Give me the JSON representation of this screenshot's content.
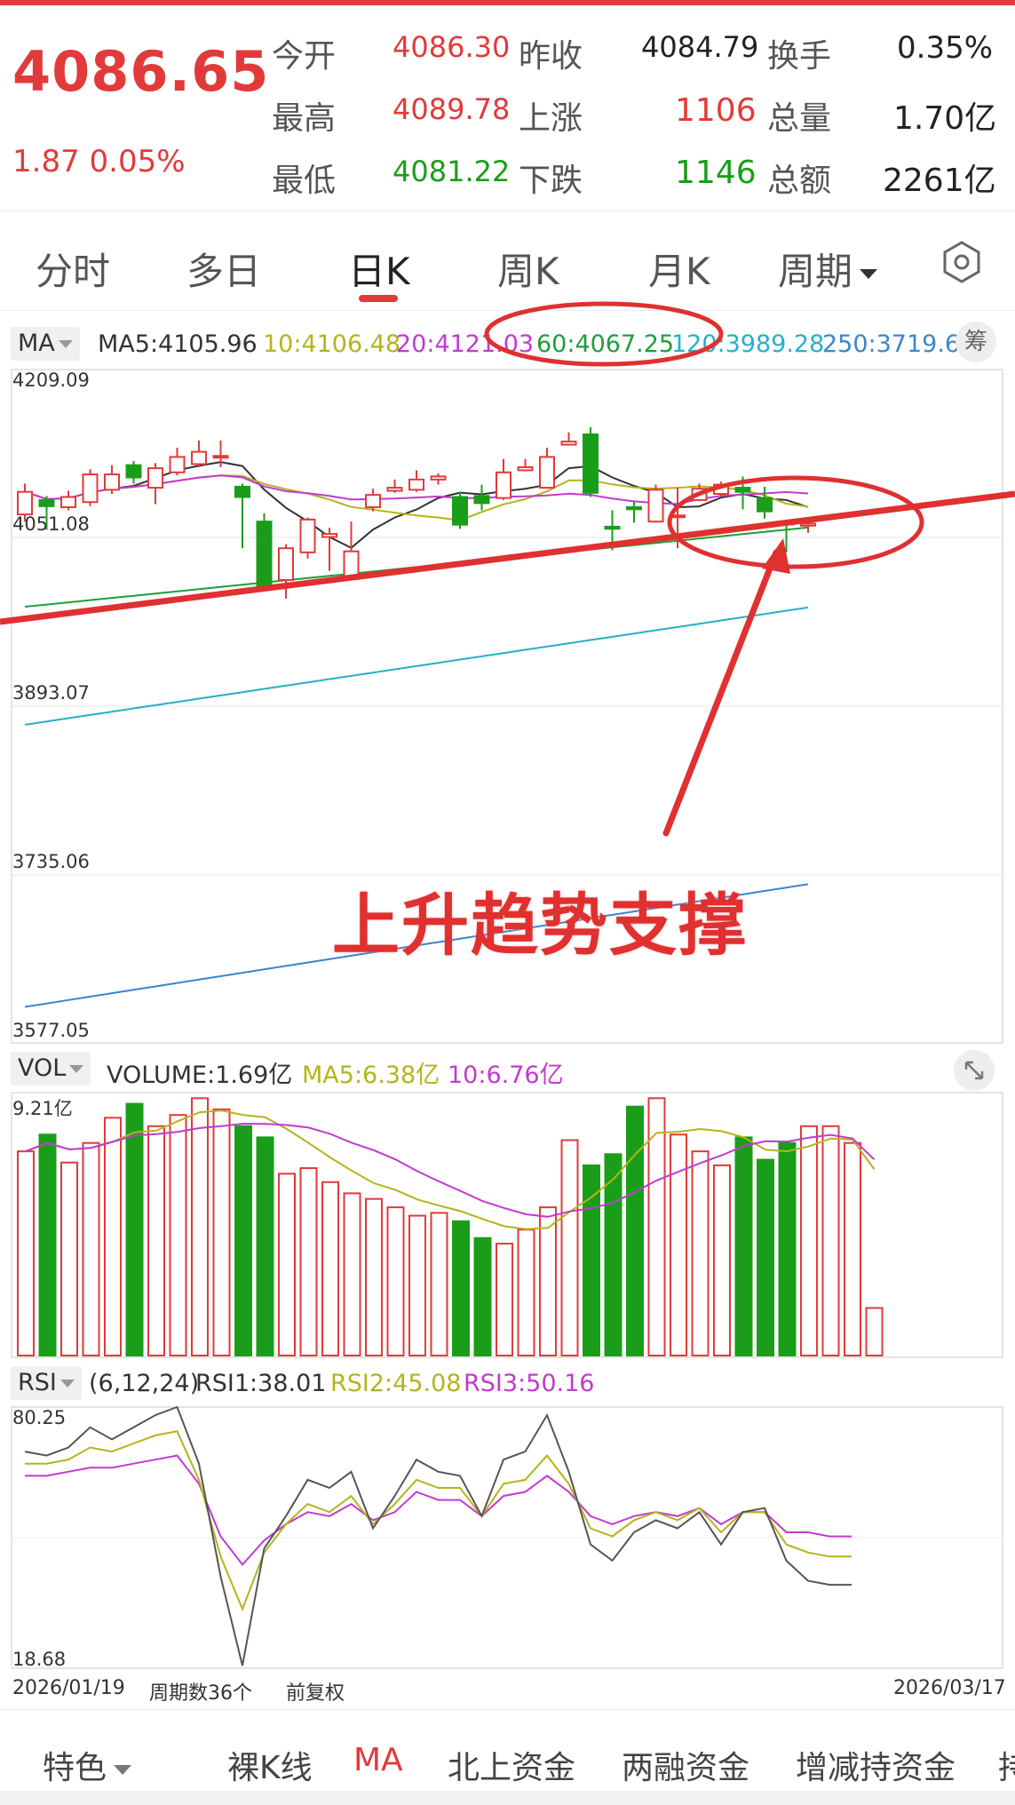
{
  "colors": {
    "up": "#e23a3a",
    "down": "#1a9e1a",
    "ma5": "#333333",
    "ma10": "#b5b41a",
    "ma20": "#c23ad0",
    "ma60": "#1f9e3a",
    "ma120": "#26b0c9",
    "ma250": "#3b86c9",
    "annotation": "#e03030"
  },
  "quote": {
    "price": "4086.65",
    "change": "1.87  0.05%",
    "rows": [
      {
        "l1": "今开",
        "v1": "4086.30",
        "l2": "昨收",
        "v2": "4084.79",
        "l3": "换手",
        "v3": "0.35%"
      },
      {
        "l1": "最高",
        "v1": "4089.78",
        "l2": "上涨",
        "v2": "1106",
        "l3": "总量",
        "v3": "1.70亿"
      },
      {
        "l1": "最低",
        "v1": "4081.22",
        "l2": "下跌",
        "v2": "1146",
        "l3": "总额",
        "v3": "2261亿"
      }
    ]
  },
  "tabs": [
    "分时",
    "多日",
    "日K",
    "周K",
    "月K",
    "周期"
  ],
  "ma_row": {
    "btn": "MA",
    "items": [
      "MA5:4105.96",
      "10:4106.48",
      "20:4121.03",
      "60:4067.25",
      "120:3989.28",
      "250:3719.6"
    ],
    "chip": "筹"
  },
  "price_axis": [
    "4209.09",
    "4051.08",
    "3893.07",
    "3735.06",
    "3577.05"
  ],
  "annotation_text": "上升趋势支撑",
  "vol_row": {
    "btn": "VOL",
    "items": [
      "VOLUME:1.69亿",
      "MA5:6.38亿",
      "10:6.76亿"
    ],
    "axis_top": "9.21亿"
  },
  "rsi_row": {
    "btn": "RSI",
    "items": [
      "(6,12,24)",
      "RSI1:38.01",
      "RSI2:45.08",
      "RSI3:50.16"
    ],
    "axis_top": "80.25",
    "axis_bottom": "18.68"
  },
  "footer": {
    "start": "2026/01/19",
    "count": "周期数36个",
    "adjust": "前复权",
    "end": "2026/03/17"
  },
  "bottom_tabs": [
    "特色",
    "裸K线",
    "MA",
    "北上资金",
    "两融资金",
    "增减持资金",
    "持"
  ],
  "chart_data": {
    "type": "candlestick",
    "price_range": [
      3577.05,
      4209.09
    ],
    "candles": [
      {
        "o": 4080,
        "c": 4102,
        "h": 4110,
        "l": 4073
      },
      {
        "o": 4094,
        "c": 4088,
        "h": 4098,
        "l": 4065
      },
      {
        "o": 4087,
        "c": 4097,
        "h": 4103,
        "l": 4084
      },
      {
        "o": 4092,
        "c": 4119,
        "h": 4124,
        "l": 4088
      },
      {
        "o": 4104,
        "c": 4119,
        "h": 4128,
        "l": 4100
      },
      {
        "o": 4128,
        "c": 4116,
        "h": 4132,
        "l": 4110
      },
      {
        "o": 4106,
        "c": 4125,
        "h": 4130,
        "l": 4090
      },
      {
        "o": 4121,
        "c": 4136,
        "h": 4145,
        "l": 4118
      },
      {
        "o": 4129,
        "c": 4141,
        "h": 4152,
        "l": 4126
      },
      {
        "o": 4137,
        "c": 4137,
        "h": 4152,
        "l": 4126
      },
      {
        "o": 4107,
        "c": 4097,
        "h": 4110,
        "l": 4047
      },
      {
        "o": 4073,
        "c": 4010,
        "h": 4081,
        "l": 4008
      },
      {
        "o": 4016,
        "c": 4047,
        "h": 4051,
        "l": 3998
      },
      {
        "o": 4043,
        "c": 4075,
        "h": 4077,
        "l": 4037
      },
      {
        "o": 4058,
        "c": 4061,
        "h": 4067,
        "l": 4025
      },
      {
        "o": 4017,
        "c": 4044,
        "h": 4073,
        "l": 4017
      },
      {
        "o": 4087,
        "c": 4099,
        "h": 4105,
        "l": 4083
      },
      {
        "o": 4103,
        "c": 4106,
        "h": 4114,
        "l": 4101
      },
      {
        "o": 4104,
        "c": 4114,
        "h": 4123,
        "l": 4102
      },
      {
        "o": 4114,
        "c": 4117,
        "h": 4120,
        "l": 4109
      },
      {
        "o": 4097,
        "c": 4070,
        "h": 4102,
        "l": 4066
      },
      {
        "o": 4098,
        "c": 4091,
        "h": 4109,
        "l": 4084
      },
      {
        "o": 4096,
        "c": 4121,
        "h": 4134,
        "l": 4094
      },
      {
        "o": 4123,
        "c": 4126,
        "h": 4134,
        "l": 4122
      },
      {
        "o": 4106,
        "c": 4136,
        "h": 4145,
        "l": 4105
      },
      {
        "o": 4148,
        "c": 4151,
        "h": 4160,
        "l": 4148
      },
      {
        "o": 4158,
        "c": 4101,
        "h": 4165,
        "l": 4097
      },
      {
        "o": 4068,
        "c": 4066,
        "h": 4084,
        "l": 4045
      },
      {
        "o": 4087,
        "c": 4085,
        "h": 4093,
        "l": 4072
      },
      {
        "o": 4073,
        "c": 4104,
        "h": 4109,
        "l": 4072
      },
      {
        "o": 4079,
        "c": 4079,
        "h": 4106,
        "l": 4047
      },
      {
        "o": 4094,
        "c": 4105,
        "h": 4110,
        "l": 4093
      },
      {
        "o": 4100,
        "c": 4109,
        "h": 4112,
        "l": 4098
      },
      {
        "o": 4106,
        "c": 4102,
        "h": 4117,
        "l": 4085
      },
      {
        "o": 4096,
        "c": 4083,
        "h": 4107,
        "l": 4076
      },
      {
        "o": 4072,
        "c": 4071,
        "h": 4074,
        "l": 4043
      },
      {
        "o": 4069,
        "c": 4071,
        "h": 4071,
        "l": 4062
      }
    ],
    "volume_max": 9.21,
    "volumes": [
      7.3,
      7.9,
      6.9,
      7.6,
      8.5,
      9.0,
      8.2,
      8.6,
      9.2,
      8.8,
      8.2,
      7.8,
      6.5,
      6.7,
      6.2,
      5.8,
      5.6,
      5.3,
      5.0,
      5.1,
      4.8,
      4.2,
      4.0,
      4.5,
      5.3,
      7.7,
      6.8,
      7.2,
      8.9,
      9.2,
      7.9,
      7.3,
      6.8,
      7.8,
      7.0,
      7.6,
      8.2,
      8.2,
      7.6,
      1.7
    ],
    "rsi_range": [
      18.68,
      80.25
    ],
    "rsi1": [
      71,
      70,
      72,
      77,
      74,
      77,
      80,
      82,
      68,
      40,
      18,
      47,
      55,
      64,
      62,
      66,
      52,
      60,
      69,
      66,
      65,
      55,
      69,
      71,
      80,
      66,
      48,
      44,
      51,
      54,
      52,
      56,
      48,
      56,
      57,
      44,
      39,
      38,
      38
    ],
    "rsi2": [
      68,
      68,
      69,
      72,
      71,
      73,
      75,
      76,
      64,
      45,
      32,
      46,
      53,
      58,
      56,
      60,
      53,
      58,
      64,
      62,
      62,
      55,
      63,
      64,
      70,
      63,
      52,
      50,
      54,
      56,
      54,
      57,
      51,
      56,
      56,
      48,
      46,
      45,
      45
    ],
    "rsi3": [
      65,
      65,
      66,
      67,
      67,
      68,
      69,
      70,
      63,
      50,
      43,
      49,
      53,
      56,
      55,
      58,
      54,
      56,
      61,
      59,
      59,
      55,
      60,
      61,
      65,
      61,
      55,
      53,
      55,
      56,
      55,
      57,
      53,
      56,
      56,
      51,
      51,
      50,
      50
    ]
  }
}
